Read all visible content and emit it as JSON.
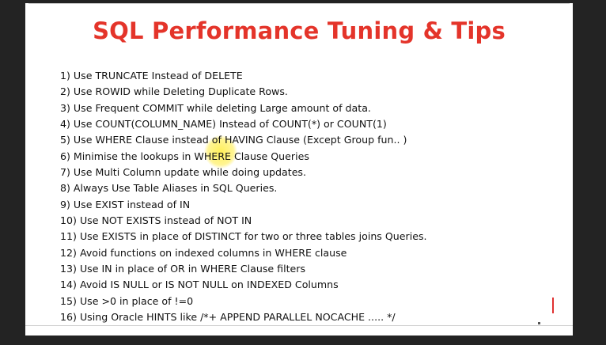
{
  "slide": {
    "title": "SQL Performance Tuning & Tips",
    "tips": [
      "1) Use TRUNCATE  Instead of DELETE",
      "2) Use ROWID while Deleting Duplicate Rows.",
      "3) Use Frequent COMMIT while deleting Large amount of data.",
      "4) Use COUNT(COLUMN_NAME)  Instead of COUNT(*) or COUNT(1)",
      "5) Use WHERE Clause instead of HAVING Clause (Except Group fun.. )",
      "6) Minimise  the lookups in WHERE Clause Queries",
      "7) Use Multi Column update while doing updates.",
      "8) Always Use Table Aliases in SQL Queries.",
      "9) Use EXIST instead of IN",
      "10) Use NOT EXISTS instead of NOT IN",
      "11) Use EXISTS in place of DISTINCT for two or three tables joins Queries.",
      "12) Avoid functions on indexed columns in WHERE clause",
      "13) Use IN in place of OR in WHERE Clause filters",
      "14) Avoid IS NULL or IS NOT NULL on INDEXED Columns",
      "15) Use >0 in place of !=0",
      "16) Using Oracle HINTS like /*+ APPEND PARALLEL NOCACHE ..... */"
    ],
    "colors": {
      "title": "#e4342a",
      "text": "#111111",
      "highlight": "#ffec3c",
      "background": "#ffffff"
    }
  }
}
